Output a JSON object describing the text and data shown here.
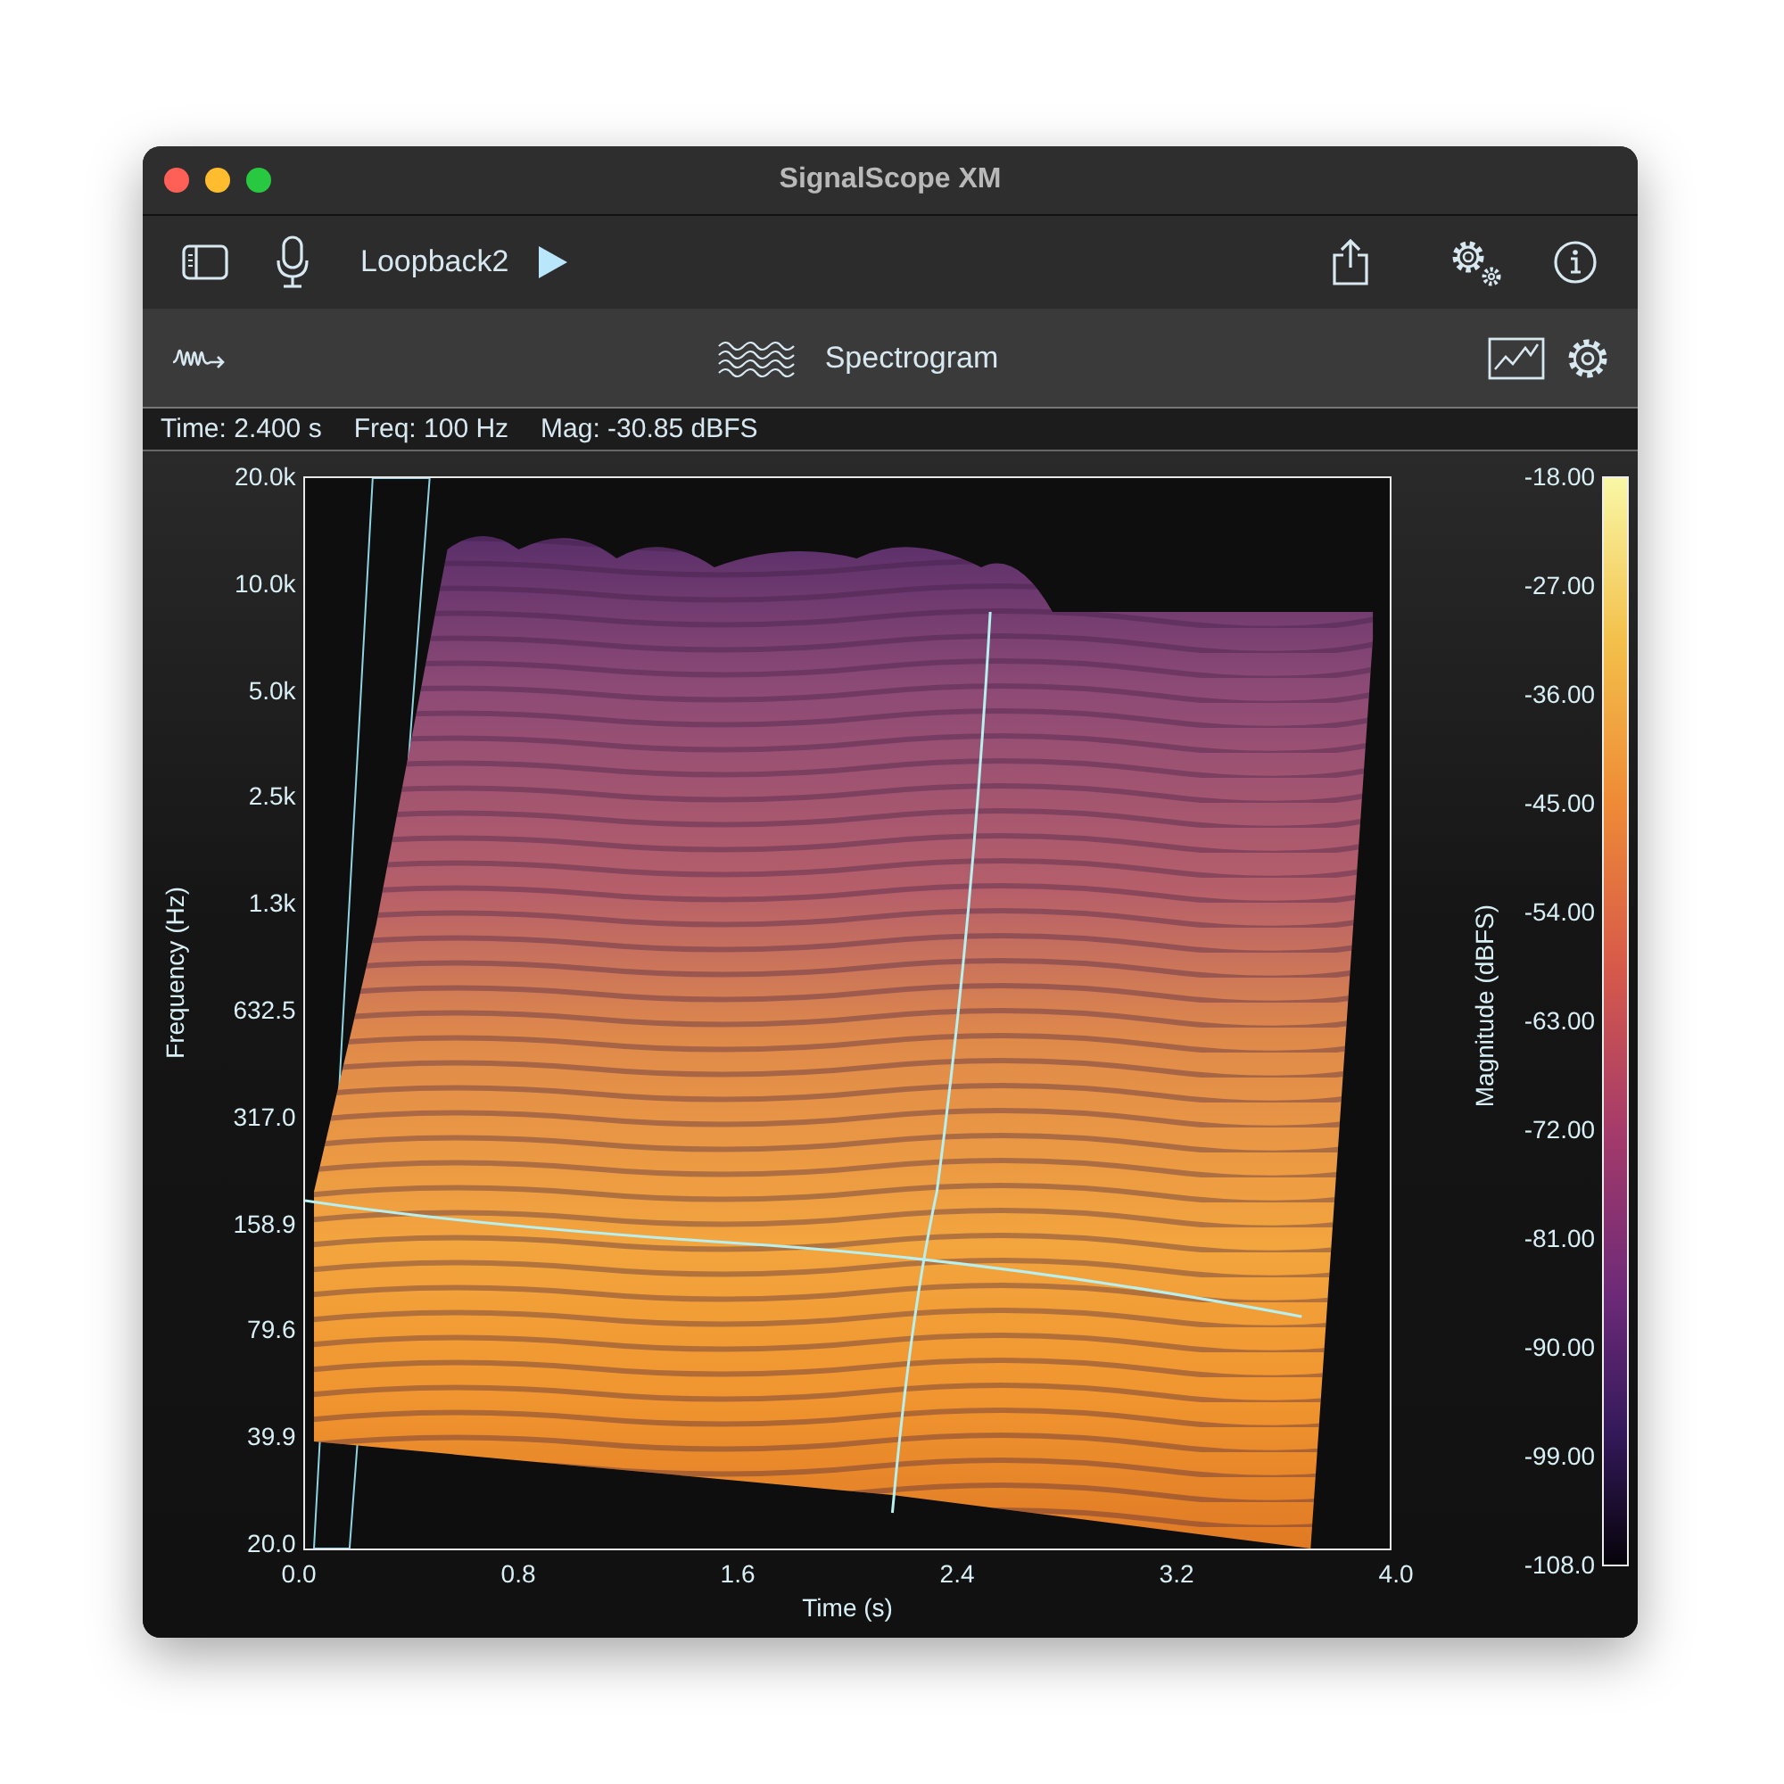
{
  "window": {
    "title": "SignalScope XM"
  },
  "toolbar": {
    "input": "Loopback2"
  },
  "analyzer": {
    "title": "Spectrogram"
  },
  "readout": [
    "Time: 2.400 s",
    "Freq: 100 Hz",
    "Mag: -30.85 dBFS"
  ],
  "plot": {
    "ylabel": "Frequency (Hz)",
    "xlabel": "Time (s)",
    "yticks": [
      "20.0k",
      "10.0k",
      "5.0k",
      "2.5k",
      "1.3k",
      "632.5",
      "317.0",
      "158.9",
      "79.6",
      "39.9",
      "20.0"
    ],
    "xticks": [
      "0.0",
      "0.8",
      "1.6",
      "2.4",
      "3.2",
      "4.0"
    ]
  },
  "colorbar": {
    "label": "Magnitude (dBFS)",
    "ticks": [
      "-18.00",
      "-27.00",
      "-36.00",
      "-45.00",
      "-54.00",
      "-63.00",
      "-72.00",
      "-81.00",
      "-90.00",
      "-99.00",
      "-108.0"
    ]
  }
}
